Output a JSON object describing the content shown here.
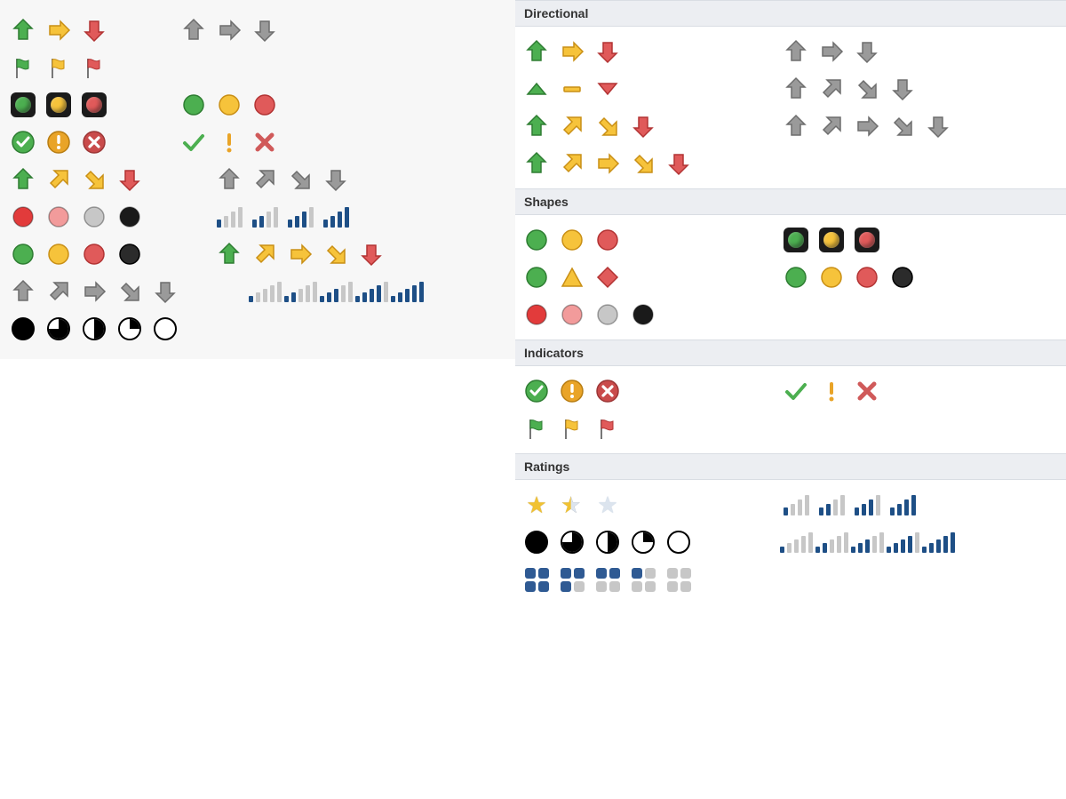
{
  "sections": {
    "directional": "Directional",
    "shapes": "Shapes",
    "indicators": "Indicators",
    "ratings": "Ratings"
  },
  "colors": {
    "green": "#4caf50",
    "yellow": "#f6c33b",
    "red": "#e05a5a",
    "gray": "#9a9a9a",
    "pink": "#f29b9b",
    "silver": "#c7c7c7",
    "black": "#1a1a1a",
    "blue": "#1e4f86",
    "amber": "#e9a428"
  },
  "left_rows": [
    {
      "a": [
        "arrow-up-green",
        "arrow-right-yellow",
        "arrow-down-red"
      ],
      "b": [
        "arrow-up-gray",
        "arrow-right-gray",
        "arrow-down-gray"
      ]
    },
    {
      "a": [
        "flag-green",
        "flag-yellow",
        "flag-red"
      ],
      "b": []
    },
    {
      "a": [
        "traffic-green",
        "traffic-yellow",
        "traffic-red"
      ],
      "b": [
        "circle-green",
        "circle-yellow",
        "circle-red"
      ]
    },
    {
      "a": [
        "symbol-check-circled",
        "symbol-exclaim-circled",
        "symbol-x-circled"
      ],
      "b": [
        "symbol-check",
        "symbol-exclaim",
        "symbol-x"
      ]
    },
    {
      "a": [
        "arrow-up-green",
        "arrow-upright-yellow",
        "arrow-downright-yellow",
        "arrow-down-red"
      ],
      "b": [
        "arrow-up-gray",
        "arrow-upright-gray",
        "arrow-downright-gray",
        "arrow-down-gray"
      ]
    },
    {
      "a": [
        "ball-red",
        "ball-pink",
        "ball-silver",
        "ball-black"
      ],
      "b": [
        "bars4-1",
        "bars4-2",
        "bars4-3",
        "bars4-4"
      ]
    },
    {
      "a": [
        "circle-green",
        "circle-yellow",
        "circle-red",
        "circle-black"
      ],
      "b": [
        "arrow-up-green",
        "arrow-upright-yellow",
        "arrow-right-yellow",
        "arrow-downright-yellow",
        "arrow-down-red"
      ]
    },
    {
      "a": [
        "arrow-up-gray",
        "arrow-upright-gray",
        "arrow-right-gray",
        "arrow-downright-gray",
        "arrow-down-gray"
      ],
      "b": [
        "bars5-0",
        "bars5-1",
        "bars5-2",
        "bars5-3",
        "bars5-4"
      ]
    },
    {
      "a": [
        "pie-100",
        "pie-75",
        "pie-50",
        "pie-25",
        "pie-0"
      ],
      "b": []
    }
  ],
  "right": {
    "directional": {
      "rows": [
        {
          "a": [
            "arrow-up-green",
            "arrow-right-yellow",
            "arrow-down-red"
          ],
          "b": [
            "arrow-up-gray",
            "arrow-right-gray",
            "arrow-down-gray"
          ]
        },
        {
          "a": [
            "tri-up-green",
            "dash-yellow",
            "tri-down-red"
          ],
          "b": [
            "arrow-up-gray",
            "arrow-upright-gray",
            "arrow-downright-gray",
            "arrow-down-gray"
          ]
        },
        {
          "a": [
            "arrow-up-green",
            "arrow-upright-yellow",
            "arrow-downright-yellow",
            "arrow-down-red"
          ],
          "b": [
            "arrow-up-gray",
            "arrow-upright-gray",
            "arrow-right-gray",
            "arrow-downright-gray",
            "arrow-down-gray"
          ]
        },
        {
          "a": [
            "arrow-up-green",
            "arrow-upright-yellow",
            "arrow-right-yellow",
            "arrow-downright-yellow",
            "arrow-down-red"
          ],
          "b": []
        }
      ]
    },
    "shapes": {
      "rows": [
        {
          "a": [
            "circle-green",
            "circle-yellow",
            "circle-red"
          ],
          "b": [
            "traffic-green",
            "traffic-yellow",
            "traffic-red"
          ]
        },
        {
          "a": [
            "circle-green",
            "triangle-yellow",
            "diamond-red"
          ],
          "b": [
            "circle-green",
            "circle-yellow",
            "circle-red",
            "circle-black"
          ]
        },
        {
          "a": [
            "ball-red",
            "ball-pink",
            "ball-silver",
            "ball-black"
          ],
          "b": []
        }
      ]
    },
    "indicators": {
      "rows": [
        {
          "a": [
            "symbol-check-circled",
            "symbol-exclaim-circled",
            "symbol-x-circled"
          ],
          "b": [
            "symbol-check",
            "symbol-exclaim",
            "symbol-x"
          ]
        },
        {
          "a": [
            "flag-green",
            "flag-yellow",
            "flag-red"
          ],
          "b": []
        }
      ]
    },
    "ratings": {
      "rows": [
        {
          "a": [
            "star-full",
            "star-half",
            "star-empty"
          ],
          "b": [
            "bars4-1",
            "bars4-2",
            "bars4-3",
            "bars4-4"
          ]
        },
        {
          "a": [
            "pie-100",
            "pie-75",
            "pie-50",
            "pie-25",
            "pie-0"
          ],
          "b": [
            "bars5-0",
            "bars5-1",
            "bars5-2",
            "bars5-3",
            "bars5-4"
          ]
        },
        {
          "a": [
            "box4-4",
            "box4-3",
            "box4-2",
            "box4-1",
            "box4-0"
          ],
          "b": []
        }
      ]
    }
  }
}
